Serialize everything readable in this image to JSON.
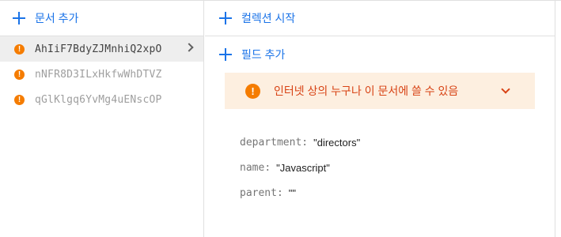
{
  "left_panel": {
    "add_document_label": "문서 추가",
    "documents": [
      {
        "id": "AhIiF7BdyZJMnhiQ2xpO",
        "selected": true
      },
      {
        "id": "nNFR8D3ILxHkfwWhDTVZ",
        "selected": false
      },
      {
        "id": "qGlKlgq6YvMg4uENscOP",
        "selected": false
      }
    ]
  },
  "right_panel": {
    "start_collection_label": "컬렉션 시작",
    "add_field_label": "필드 추가",
    "warning_text": "인터넷 상의 누구나 이 문서에 쓸 수 있음",
    "fields": [
      {
        "key": "department",
        "value": "\"directors\""
      },
      {
        "key": "name",
        "value": "\"Javascript\""
      },
      {
        "key": "parent",
        "value": "\"\""
      }
    ]
  },
  "colors": {
    "accent": "#1a73e8",
    "warning": "#f57c00",
    "warning_text": "#d84315",
    "warning_bg": "#fdefe0",
    "selected_bg": "#eeeeee"
  }
}
